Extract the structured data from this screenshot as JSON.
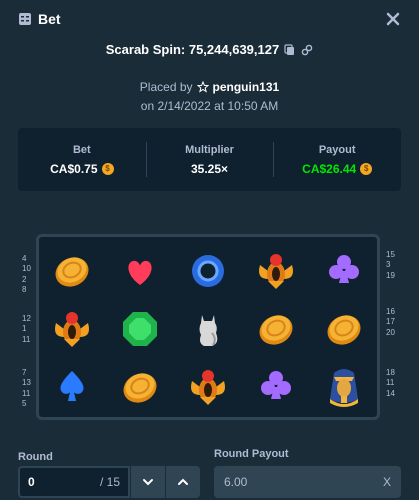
{
  "header": {
    "title": "Bet"
  },
  "spin": {
    "label": "Scarab Spin: 75,244,639,127"
  },
  "placed": {
    "prefix": "Placed by",
    "user": "penguin131",
    "date": "on 2/14/2022 at 10:50 AM"
  },
  "stats": {
    "bet_label": "Bet",
    "bet_value": "CA$0.75",
    "multiplier_label": "Multiplier",
    "multiplier_value": "35.25×",
    "payout_label": "Payout",
    "payout_value": "CA$26.44",
    "currency_symbol": "$"
  },
  "paylines": {
    "left_top": [
      "4",
      "10",
      "2",
      "8"
    ],
    "left_mid": [
      "12",
      "1",
      "11"
    ],
    "left_bot": [
      "7",
      "13",
      "11",
      "5"
    ],
    "right_top": [
      "15",
      "3",
      "19"
    ],
    "right_mid": [
      "16",
      "17",
      "20"
    ],
    "right_bot": [
      "18",
      "11",
      "14"
    ]
  },
  "grid": [
    [
      "coin",
      "heart",
      "ring",
      "scarab",
      "club"
    ],
    [
      "scarab",
      "emerald",
      "cat",
      "coin",
      "coin"
    ],
    [
      "spade",
      "coin",
      "scarab",
      "club",
      "pharaoh"
    ]
  ],
  "round": {
    "label": "Round",
    "value": "0",
    "of": "/ 15"
  },
  "round_payout": {
    "label": "Round Payout",
    "value": "6.00",
    "clear": "X"
  }
}
